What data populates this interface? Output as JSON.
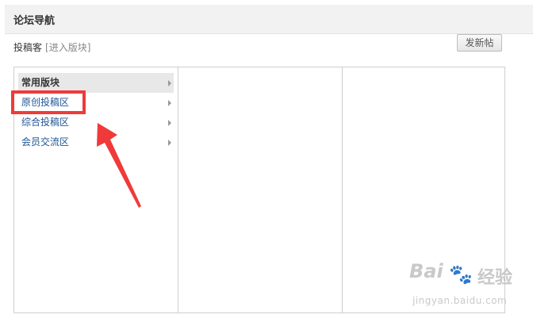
{
  "header": {
    "title": "论坛导航"
  },
  "forum": {
    "name": "投稿客",
    "enter_link": "[进入版块]"
  },
  "actions": {
    "new_post_label": "发新帖"
  },
  "categories": [
    {
      "label": "常用版块",
      "active": true
    },
    {
      "label": "原创投稿区",
      "active": false
    },
    {
      "label": "综合投稿区",
      "active": false
    },
    {
      "label": "会员交流区",
      "active": false
    }
  ],
  "annotation": {
    "color": "#f03a3a"
  },
  "watermark": {
    "brand": "Bai",
    "paw": "🐾",
    "jingyan": "经验",
    "url": "jingyan.baidu.com"
  }
}
